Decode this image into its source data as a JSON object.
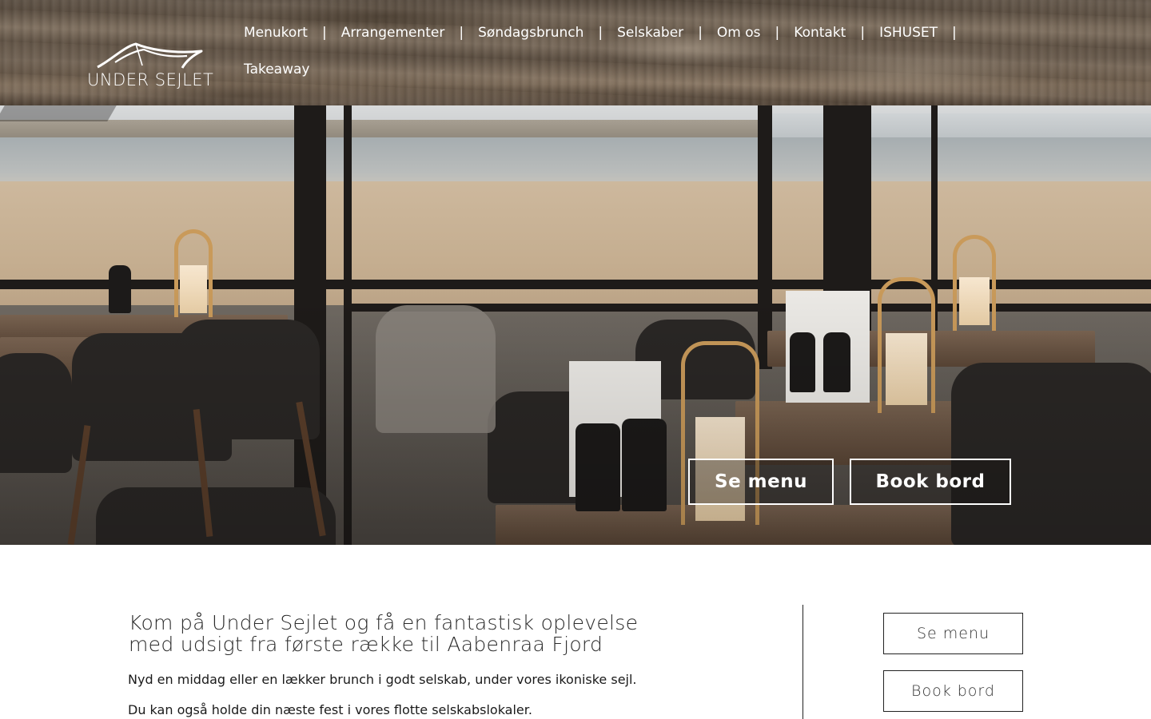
{
  "brand": {
    "logo_text": "UNDER SEJLET",
    "logo_icon": "sail-icon"
  },
  "nav": {
    "items": [
      {
        "label": "Menukort"
      },
      {
        "label": "Arrangementer"
      },
      {
        "label": "Søndagsbrunch"
      },
      {
        "label": "Selskaber"
      },
      {
        "label": "Om os"
      },
      {
        "label": "Kontakt"
      },
      {
        "label": "ISHUSET"
      },
      {
        "label": "Takeaway"
      }
    ],
    "separator": "|"
  },
  "hero": {
    "buttons": {
      "menu": "Se menu",
      "book": "Book bord"
    }
  },
  "intro": {
    "title": "Kom på Under Sejlet og få en fantastisk oplevelse med udsigt fra første række til Aabenraa Fjord",
    "paragraph1": "Nyd en middag eller en lækker brunch i godt selskab, under vores ikoniske sejl.",
    "paragraph2": "Du kan også holde din næste fest i vores flotte selskabslokaler."
  },
  "side_buttons": {
    "menu": "Se menu",
    "book": "Book bord"
  },
  "colors": {
    "header_wood": "#6e5f50",
    "button_border": "#ffffff",
    "text": "#222222"
  }
}
